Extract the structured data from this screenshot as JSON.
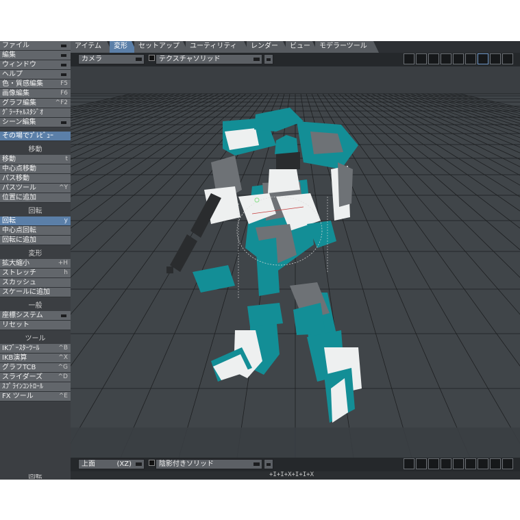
{
  "left_menu": {
    "top_items": [
      {
        "label": "ファイル",
        "shortcut": "",
        "dropdown": true
      },
      {
        "label": "編集",
        "shortcut": "",
        "dropdown": true
      },
      {
        "label": "ウィンドウ",
        "shortcut": "",
        "dropdown": true
      },
      {
        "label": "ヘルプ",
        "shortcut": "",
        "dropdown": true
      },
      {
        "label": "色・質感編集",
        "shortcut": "F5",
        "dropdown": false
      },
      {
        "label": "画像編集",
        "shortcut": "F6",
        "dropdown": false
      },
      {
        "label": "グラフ編集",
        "shortcut": "^F2",
        "dropdown": false
      },
      {
        "label": "ｸﾞﾗｰﾁｬﾙｽﾀｼﾞｵ",
        "shortcut": "",
        "dropdown": false
      },
      {
        "label": "シーン編集",
        "shortcut": "",
        "dropdown": true
      }
    ],
    "quick_item": {
      "label": "その場でﾌﾟﾚﾋﾞｭｰ"
    },
    "groups": [
      {
        "title": "移動",
        "items": [
          {
            "label": "移動",
            "shortcut": "t",
            "active": false
          },
          {
            "label": "中心点移動",
            "shortcut": "",
            "active": false
          },
          {
            "label": "パス移動",
            "shortcut": "",
            "active": false
          },
          {
            "label": "パスツール",
            "shortcut": "^Y",
            "active": false
          },
          {
            "label": "位置に追加",
            "shortcut": "",
            "active": false
          }
        ]
      },
      {
        "title": "回転",
        "items": [
          {
            "label": "回転",
            "shortcut": "y",
            "active": true
          },
          {
            "label": "中心点回転",
            "shortcut": "",
            "active": false
          },
          {
            "label": "回転に追加",
            "shortcut": "",
            "active": false
          }
        ]
      },
      {
        "title": "変形",
        "items": [
          {
            "label": "拡大縮小",
            "shortcut": "+H",
            "active": false
          },
          {
            "label": "ストレッチ",
            "shortcut": "h",
            "active": false
          },
          {
            "label": "スカッシュ",
            "shortcut": "",
            "active": false
          },
          {
            "label": "スケールに追加",
            "shortcut": "",
            "active": false
          }
        ]
      },
      {
        "title": "一般",
        "items": [
          {
            "label": "座標システム",
            "shortcut": "",
            "active": false,
            "dropdown": true
          },
          {
            "label": "リセット",
            "shortcut": "",
            "active": false
          }
        ]
      },
      {
        "title": "ツール",
        "items": [
          {
            "label": "IKﾌﾞｰｽﾀｰﾂｰﾙ",
            "shortcut": "^B",
            "active": false
          },
          {
            "label": "IKB演算",
            "shortcut": "^X",
            "active": false
          },
          {
            "label": "グラフTCB",
            "shortcut": "^G",
            "active": false
          },
          {
            "label": "スライダーズ",
            "shortcut": "^D",
            "active": false
          },
          {
            "label": "ｽﾌﾟﾗｲﾝｺﾝﾄﾛｰﾙ",
            "shortcut": "",
            "active": false
          },
          {
            "label": "FX ツール",
            "shortcut": "^E",
            "active": false
          }
        ]
      }
    ],
    "bottom_label": "回転"
  },
  "tabs": [
    {
      "label": "アイテム",
      "active": false
    },
    {
      "label": "変形",
      "active": true
    },
    {
      "label": "セットアップ",
      "active": false
    },
    {
      "label": "ユーティリティ",
      "active": false
    },
    {
      "label": "レンダー",
      "active": false
    },
    {
      "label": "ビュー",
      "active": false
    },
    {
      "label": "モデラーツール",
      "active": false
    }
  ],
  "viewport_top": {
    "view_label": "カメラ",
    "shading_label": "テクスチャソリッド"
  },
  "viewport_bottom": {
    "view_label": "上面",
    "axis_label": "(XZ)",
    "shading_label": "陰影付きソリッド",
    "ruler_text": "+I+I+X+I+I+X"
  },
  "colors": {
    "accent": "#5b7fa8",
    "robot_teal": "#138e96",
    "robot_white": "#eef0f0",
    "robot_gray": "#6e7276",
    "weapon_dark": "#2a2c2e"
  },
  "icons": [
    "view-icon-1",
    "view-icon-2",
    "view-icon-3",
    "view-icon-4",
    "view-icon-5",
    "view-icon-6",
    "view-icon-7",
    "view-icon-8",
    "view-icon-9"
  ]
}
